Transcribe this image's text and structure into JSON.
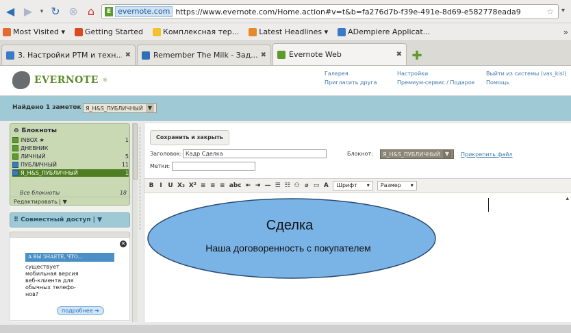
{
  "browser": {
    "site_badge": "E",
    "site_host": "evernote.com",
    "url": "https://www.evernote.com/Home.action#v=t&b=fa276d7b-f39e-491e-8d69-e582778eada9",
    "bookmarks": [
      {
        "label": "Most Visited ▾",
        "color": "#e36b2c"
      },
      {
        "label": "Getting Started",
        "color": "#d94a1e"
      },
      {
        "label": "Комплексная тер...",
        "color": "#f2c12e"
      },
      {
        "label": "Latest Headlines ▾",
        "color": "#e6892a"
      },
      {
        "label": "ADempiere Applicat...",
        "color": "#3a7bc8"
      }
    ],
    "tabs": [
      {
        "label": "3. Настройки PTM и техн...",
        "color": "#3a7bc8"
      },
      {
        "label": "Remember The Milk - Зад...",
        "color": "#2f6fb7"
      },
      {
        "label": "Evernote Web",
        "color": "#5f9a2c"
      }
    ],
    "tab_close": "✖",
    "new_tab": "✚"
  },
  "header": {
    "logo_text": "EVERNOTE",
    "links": {
      "gallery": "Галерея",
      "invite": "Пригласить друга",
      "settings": "Настройки",
      "premium": "Премиум-сервис / Подарок",
      "logout": "Выйти из системы (vas_kisl)",
      "help": "Помощь"
    }
  },
  "found_bar": {
    "text": "Найдено 1 заметок в",
    "notebook": "Я_H&S_ПУБЛИЧНЫЙ",
    "arrow": "▼"
  },
  "sidebar": {
    "notebooks_title": "Блокноты",
    "notebooks": [
      {
        "name": "INBOX ★",
        "count": "1",
        "shared": false,
        "selected": false
      },
      {
        "name": "ДНЕВНИК",
        "count": "",
        "shared": false,
        "selected": false
      },
      {
        "name": "ЛИЧНЫЙ",
        "count": "5",
        "shared": false,
        "selected": false
      },
      {
        "name": "ПУБЛИЧНЫЙ",
        "count": "11",
        "shared": true,
        "selected": false
      },
      {
        "name": "Я_H&S_ПУБЛИЧНЫЙ",
        "count": "1",
        "shared": true,
        "selected": true
      }
    ],
    "all_notebooks": "Все блокноты",
    "all_count": "18",
    "edit": "Редактировать | ▼",
    "shared_access": "Совместный доступ | ▼"
  },
  "promo": {
    "close": "✕",
    "headline": "А ВЫ ЗНАЕТЕ, ЧТО...",
    "lines": [
      "существует",
      "мобильная версия",
      "веб-клиента для",
      "обычных телефо-",
      "нов?"
    ],
    "more": "подробнее ➔"
  },
  "editor": {
    "save_close": "Сохранить и закрыть",
    "title_label": "Заголовок:",
    "title_value": "Кадр Сделка",
    "tags_label": "Метки:",
    "notebook_label": "Блокнот:",
    "notebook_value": "Я_H&S_ПУБЛИЧНЫЙ",
    "attach": "Прикрепить файл",
    "toolbar": [
      "B",
      "I",
      "U",
      "X₂",
      "X²",
      "≡",
      "≡",
      "≡",
      "abc",
      "⇤",
      "⇥",
      "—",
      "☰",
      "☷",
      "⚇",
      "⌀",
      "▭",
      "A"
    ],
    "font_label": "Шрифт",
    "size_label": "Размер"
  },
  "diagram": {
    "title": "Сделка",
    "subtitle": "Наша договоренность с покупателем",
    "fill": "#7ab3e6",
    "stroke": "#2a4c73"
  }
}
